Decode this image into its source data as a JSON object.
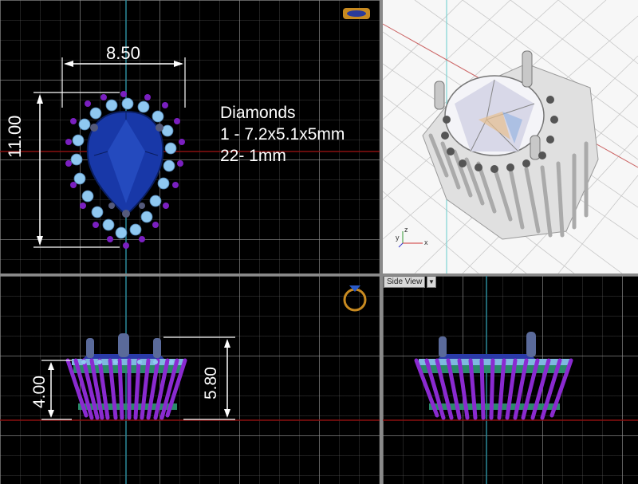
{
  "dimensions": {
    "width": "8.50",
    "height": "11.00",
    "base_height": "4.00",
    "total_height": "5.80"
  },
  "notes": {
    "title": "Diamonds",
    "line1": "1 - 7.2x5.1x5mm",
    "line2": "22- 1mm"
  },
  "viewports": {
    "top_right_label": "Side View",
    "dropdown_glyph": "▼"
  },
  "colors": {
    "sapphire": "#1838a8",
    "halo": "#8fc8f0",
    "prongs": "#7a1fc0",
    "axis_red": "#8a1010",
    "axis_cyan": "#2a8a9a"
  },
  "axis_labels": {
    "y": "y",
    "z": "z",
    "x": "x"
  }
}
